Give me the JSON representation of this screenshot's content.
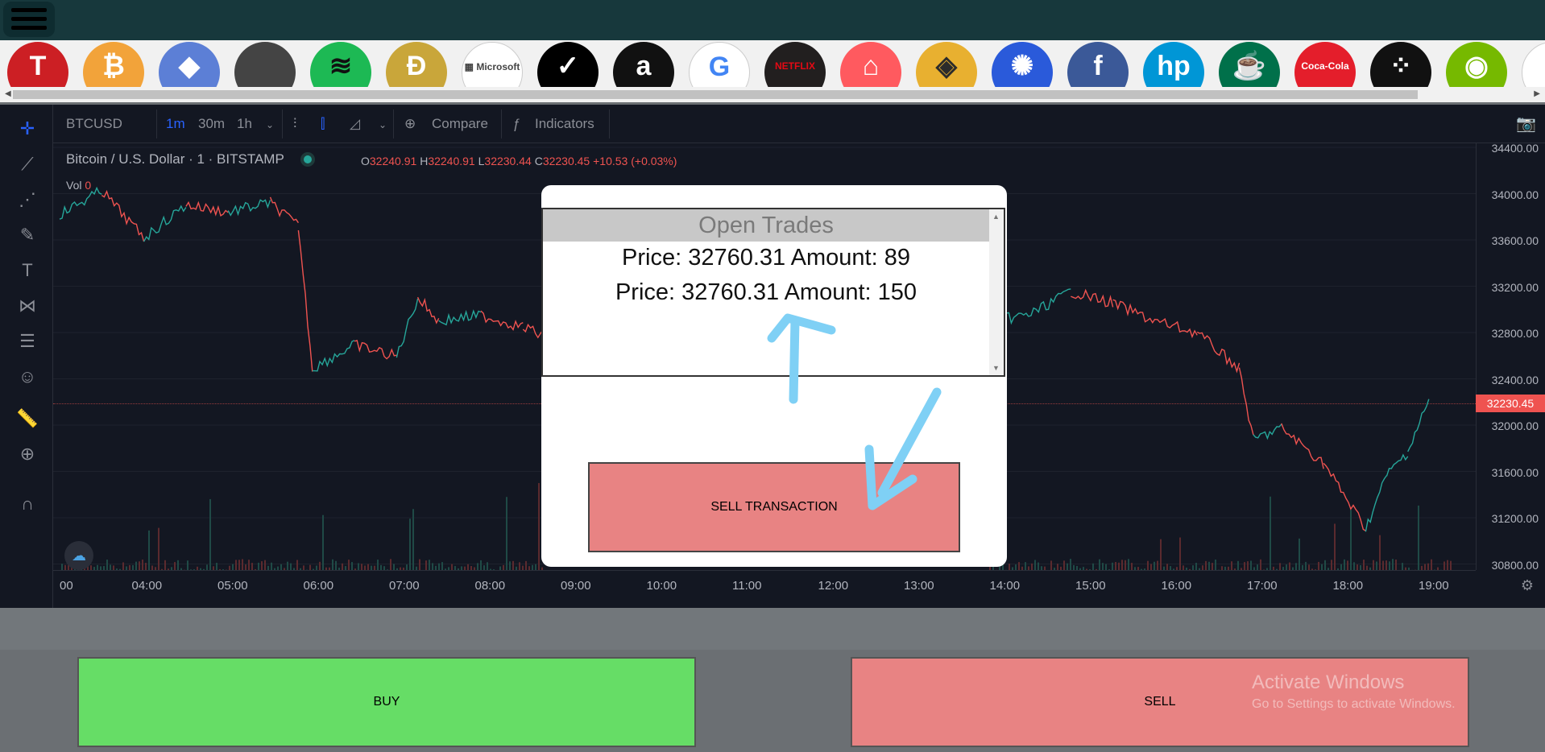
{
  "ticker": [
    {
      "name": "tesla",
      "glyph": "T",
      "bg": "#cc1f24",
      "fg": "#ffffff"
    },
    {
      "name": "bitcoin",
      "glyph": "₿",
      "bg": "#f2a33a",
      "fg": "#ffffff"
    },
    {
      "name": "ethereum",
      "glyph": "◆",
      "bg": "#5c7fd6",
      "fg": "#ffffff"
    },
    {
      "name": "apple",
      "glyph": "",
      "bg": "#444444",
      "fg": "#ffffff"
    },
    {
      "name": "spotify",
      "glyph": "≋",
      "bg": "#1db954",
      "fg": "#111111"
    },
    {
      "name": "dogecoin",
      "glyph": "Ð",
      "bg": "#c9a63a",
      "fg": "#ffffff"
    },
    {
      "name": "microsoft",
      "glyph": "▦ Microsoft",
      "bg": "#ffffff",
      "fg": "#444444"
    },
    {
      "name": "nike",
      "glyph": "✓",
      "bg": "#000000",
      "fg": "#ffffff"
    },
    {
      "name": "amazon",
      "glyph": "a",
      "bg": "#111111",
      "fg": "#ffffff"
    },
    {
      "name": "google",
      "glyph": "G",
      "bg": "#ffffff",
      "fg": "#4285f4"
    },
    {
      "name": "netflix",
      "glyph": "NETFLIX",
      "bg": "#221f1f",
      "fg": "#e50914"
    },
    {
      "name": "airbnb",
      "glyph": "⌂",
      "bg": "#ff5a5f",
      "fg": "#ffffff"
    },
    {
      "name": "binance",
      "glyph": "◈",
      "bg": "#e8b030",
      "fg": "#2b2b2b"
    },
    {
      "name": "cardano",
      "glyph": "✺",
      "bg": "#2a5ada",
      "fg": "#ffffff"
    },
    {
      "name": "facebook",
      "glyph": "f",
      "bg": "#3b5998",
      "fg": "#ffffff"
    },
    {
      "name": "hp",
      "glyph": "hp",
      "bg": "#0096d6",
      "fg": "#ffffff"
    },
    {
      "name": "starbucks",
      "glyph": "☕",
      "bg": "#00704a",
      "fg": "#ffffff"
    },
    {
      "name": "coca-cola",
      "glyph": "Coca-Cola",
      "bg": "#e41e2b",
      "fg": "#ffffff"
    },
    {
      "name": "blackberry",
      "glyph": "⁘",
      "bg": "#111111",
      "fg": "#ffffff"
    },
    {
      "name": "nvidia",
      "glyph": "◉",
      "bg": "#76b900",
      "fg": "#ffffff"
    },
    {
      "name": "partial",
      "glyph": "",
      "bg": "#ffffff",
      "fg": "#1a3a8a"
    }
  ],
  "toolbar": {
    "symbol": "BTCUSD",
    "intervals": [
      "1m",
      "30m",
      "1h"
    ],
    "compare": "Compare",
    "indicators": "Indicators"
  },
  "legend": {
    "title": "Bitcoin / U.S. Dollar · 1 · BITSTAMP",
    "o_label": "O",
    "o": "32240.91",
    "h_label": "H",
    "h": "32240.91",
    "l_label": "L",
    "l": "32230.44",
    "c_label": "C",
    "c": "32230.45",
    "change": "+10.53 (+0.03%)",
    "vol_label": "Vol",
    "vol": "0"
  },
  "price_axis": [
    "34400.00",
    "34000.00",
    "33600.00",
    "33200.00",
    "32800.00",
    "32400.00",
    "32000.00",
    "31600.00",
    "31200.00",
    "30800.00"
  ],
  "current_price": "32230.45",
  "time_axis": [
    "00",
    "04:00",
    "05:00",
    "06:00",
    "07:00",
    "08:00",
    "09:00",
    "10:00",
    "11:00",
    "12:00",
    "13:00",
    "14:00",
    "15:00",
    "16:00",
    "17:00",
    "18:00",
    "19:00"
  ],
  "chart_data": {
    "type": "line",
    "title": "Bitcoin / U.S. Dollar · 1 · BITSTAMP",
    "x": [
      "03:00",
      "03:30",
      "04:00",
      "04:30",
      "05:00",
      "05:30",
      "05:50",
      "06:00",
      "06:30",
      "07:00",
      "07:15",
      "07:30",
      "08:00",
      "08:30",
      "09:00",
      "14:00",
      "14:30",
      "15:00",
      "15:30",
      "16:00",
      "16:30",
      "17:00",
      "17:10",
      "17:30",
      "18:00",
      "18:30",
      "18:45",
      "19:00",
      "19:15"
    ],
    "series": [
      {
        "values": [
          33800,
          34000,
          33600,
          33880,
          33820,
          33900,
          33700,
          32500,
          32700,
          32600,
          33100,
          32900,
          32950,
          32850,
          32700,
          32900,
          32950,
          33150,
          33050,
          32900,
          32800,
          32500,
          31900,
          32000,
          31700,
          31150,
          31600,
          31800,
          32230
        ]
      }
    ],
    "ylim": [
      30800,
      34400
    ],
    "grid": true
  },
  "modal": {
    "title": "Open Trades",
    "trades": [
      {
        "price_label": "Price:",
        "price": "32760.31",
        "amount_label": "Amount:",
        "amount": "89"
      },
      {
        "price_label": "Price:",
        "price": "32760.31",
        "amount_label": "Amount:",
        "amount": "150"
      }
    ],
    "sell_label": "SELL TRANSACTION"
  },
  "buttons": {
    "buy": "BUY",
    "sell": "SELL"
  },
  "watermark": {
    "line1": "Activate Windows",
    "line2": "Go to Settings to activate Windows."
  },
  "colors": {
    "buy": "#66dd66",
    "sell": "#e88383",
    "annotation": "#7fd0f5",
    "down": "#ef5350",
    "up": "#26a69a"
  }
}
